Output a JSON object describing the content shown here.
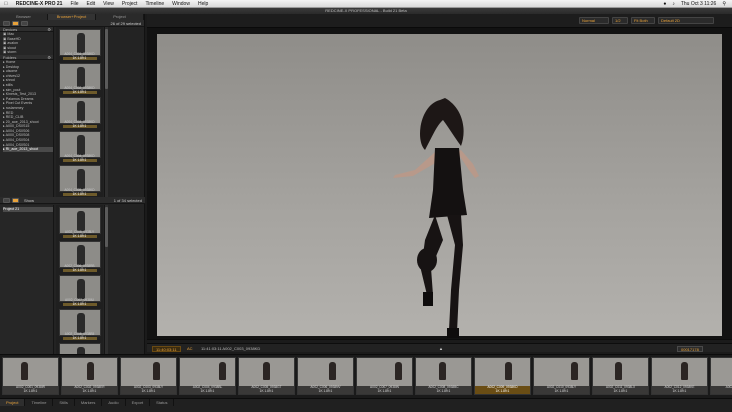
{
  "menubar": {
    "app_name": "REDCINE-X PRO 21",
    "items": [
      "File",
      "Edit",
      "View",
      "Project",
      "Timeline",
      "Window",
      "Help"
    ],
    "clock": "Thu Oct 3 11:26"
  },
  "window": {
    "title": "REDCINE-X PROFESSIONAL - Build 21 Beta"
  },
  "left": {
    "tabs": [
      "Browser",
      "Browser+Project",
      "Project"
    ],
    "active_tab": "Browser+Project",
    "status_top": "26 of 29 selected",
    "devices_header": "Devices",
    "devices": [
      "Mac",
      "BaseHD",
      "avalon",
      "skout",
      "storm"
    ],
    "folders_header": "Folders",
    "folders": [
      "Home",
      "Desktop",
      "ulsome",
      "chives12",
      "shrod",
      "stills",
      "sim_pout",
      "Kinesis_Test_2013",
      "Palamos Dreams",
      "Pixel Cut Events",
      "ruslammey",
      "RED",
      "RED_CLIB",
      "20_aoe_2013_shoot",
      "A000_DS0S15",
      "A004_DS0S06",
      "A000_DS0S08",
      "A004_DS0S04",
      "A004_DS0S01",
      "RI_aoe_2013_shoot"
    ],
    "selected_folder": "RI_aoe_2013_shoot",
    "status_bottom": "1 of 34 selected",
    "show_label": "Show",
    "project_item": "Project 21",
    "thumbs_top": [
      {
        "name": "A004_C001_0938KD",
        "tag": "1K 1.89:1"
      },
      {
        "name": "A004_C002_0938KD",
        "tag": "1K 1.89:1"
      },
      {
        "name": "A004_C003_0938KD",
        "tag": "1K 1.89:1"
      },
      {
        "name": "A004_C004_0938KD",
        "tag": "1K 1.89:1"
      },
      {
        "name": "A004_C005_0938KD",
        "tag": "1K 1.89:1"
      }
    ],
    "thumbs_bottom": [
      {
        "name": "A002_C005_0938LY",
        "tag": "1K 1.89:1"
      },
      {
        "name": "A002_C006_0938RB",
        "tag": "1K 1.89:1"
      },
      {
        "name": "A002_C007_0938IU",
        "tag": "1K 1.89:1"
      },
      {
        "name": "A002_C008_0938B5",
        "tag": "1K 1.89:1"
      },
      {
        "name": "A002_C009_0938BC",
        "tag": "1K 1.89:1"
      }
    ]
  },
  "viewer": {
    "mode": "Normal",
    "resolution": "1/2",
    "fit": "Fit Both",
    "lut": "Default 2D",
    "timecode": "11:40:03:11",
    "clip_label": "11:41:03:11  A002_C003_0938KD",
    "ac_label": "AC",
    "frame_right": "00017178"
  },
  "filmstrip": [
    {
      "name": "A002_C001_0938IR",
      "res": "1K 1.89:1"
    },
    {
      "name": "A002_C002_0938ER",
      "res": "1K 1.89:1"
    },
    {
      "name": "A002_C003_0938LY",
      "res": "1K 1.89:1"
    },
    {
      "name": "A002_C004_0938BL",
      "res": "1K 1.89:1"
    },
    {
      "name": "A002_C005_0938GT",
      "res": "1K 1.89:1"
    },
    {
      "name": "A002_C006_0938NV",
      "res": "1K 1.89:1"
    },
    {
      "name": "A002_C007_0938IN",
      "res": "1K 1.89:1"
    },
    {
      "name": "A002_C008_0938BC",
      "res": "1K 1.89:1"
    },
    {
      "name": "A002_C009_0938KD",
      "res": "1K 1.89:1"
    },
    {
      "name": "A002_C010_0938LY",
      "res": "1K 1.89:1"
    },
    {
      "name": "A002_C011_0938LX",
      "res": "1K 1.89:1"
    },
    {
      "name": "A002_C012_0938KE",
      "res": "1K 1.89:1"
    },
    {
      "name": "A002_C013_0938",
      "res": "1K 1.89:1"
    }
  ],
  "filmstrip_selected_index": 8,
  "bottom_tabs": [
    "Project",
    "Timeline",
    "Stills",
    "Markers",
    "Audio",
    "Export",
    "Status"
  ],
  "bottom_active": "Project",
  "colors": {
    "accent": "#e8a23a",
    "panel": "#232323",
    "viewer_bg": "#121212"
  }
}
